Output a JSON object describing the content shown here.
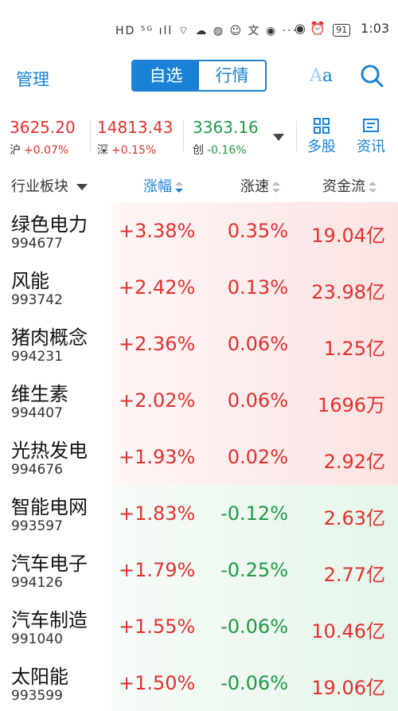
{
  "status": {
    "left_icons": "HD ⁵ᴳ ıll ⌔ ☁ ◍ ☺ 文 ◉ ···",
    "battery": "91",
    "time": "1:03"
  },
  "topbar": {
    "manage": "管理",
    "tabs": [
      "自选",
      "行情"
    ],
    "font_label_a": "A",
    "font_label_b": "a"
  },
  "indices": [
    {
      "value": "3625.20",
      "name": "沪",
      "change": "+0.07%"
    },
    {
      "value": "14813.43",
      "name": "深",
      "change": "+0.15%"
    },
    {
      "value": "3363.16",
      "name": "创",
      "change": "-0.16%"
    }
  ],
  "tools": {
    "multi": "多股",
    "news": "资讯"
  },
  "header": {
    "col1": "行业板块",
    "col2": "涨幅",
    "col3": "涨速",
    "col4": "资金流"
  },
  "rows": [
    {
      "name": "绿色电力",
      "code": "994677",
      "pct": "+3.38%",
      "speed": "0.35%",
      "flow": "19.04亿",
      "dir": "up"
    },
    {
      "name": "风能",
      "code": "993742",
      "pct": "+2.42%",
      "speed": "0.13%",
      "flow": "23.98亿",
      "dir": "up"
    },
    {
      "name": "猪肉概念",
      "code": "994231",
      "pct": "+2.36%",
      "speed": "0.06%",
      "flow": "1.25亿",
      "dir": "up"
    },
    {
      "name": "维生素",
      "code": "994407",
      "pct": "+2.02%",
      "speed": "0.06%",
      "flow": "1696万",
      "dir": "up"
    },
    {
      "name": "光热发电",
      "code": "994676",
      "pct": "+1.93%",
      "speed": "0.02%",
      "flow": "2.92亿",
      "dir": "up"
    },
    {
      "name": "智能电网",
      "code": "993597",
      "pct": "+1.83%",
      "speed": "-0.12%",
      "flow": "2.63亿",
      "dir": "dn"
    },
    {
      "name": "汽车电子",
      "code": "994126",
      "pct": "+1.79%",
      "speed": "-0.25%",
      "flow": "2.77亿",
      "dir": "dn"
    },
    {
      "name": "汽车制造",
      "code": "991040",
      "pct": "+1.55%",
      "speed": "-0.06%",
      "flow": "10.46亿",
      "dir": "dn"
    },
    {
      "name": "太阳能",
      "code": "993599",
      "pct": "+1.50%",
      "speed": "-0.06%",
      "flow": "19.06亿",
      "dir": "dn"
    }
  ],
  "colors": {
    "accent": "#1a82d6",
    "up": "#e0312e",
    "down": "#1f9a47"
  }
}
